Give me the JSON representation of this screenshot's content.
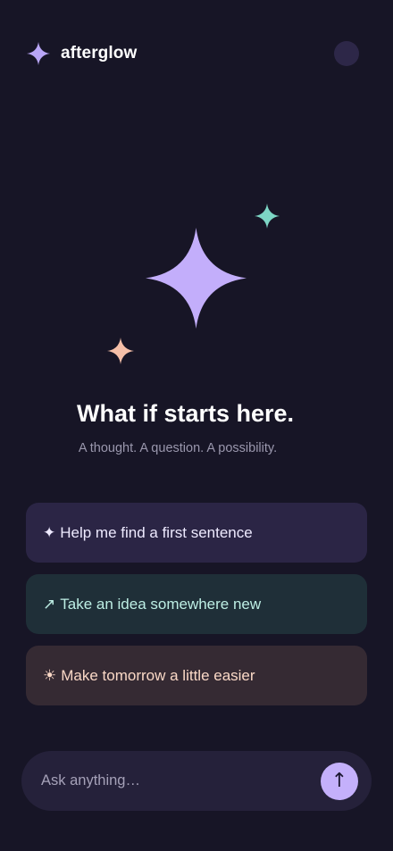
{
  "app": {
    "name": "afterglow",
    "logo_icon": "sparkle-icon",
    "avatar_icon": "avatar"
  },
  "hero": {
    "headline": "What if starts here.",
    "subline": "A thought. A question. A possibility.",
    "decor_icons": [
      "sparkle-large-icon",
      "sparkle-teal-icon",
      "sparkle-peach-icon"
    ]
  },
  "suggestions": [
    {
      "glyph": "✦",
      "icon": "sparkle-icon",
      "label": "Help me find a first sentence"
    },
    {
      "glyph": "↗",
      "icon": "arrow-up-right-icon",
      "label": "Take an idea somewhere new"
    },
    {
      "glyph": "☀",
      "icon": "sun-icon",
      "label": "Make tomorrow a little easier"
    }
  ],
  "composer": {
    "placeholder": "Ask anything…",
    "value": "",
    "send_glyph": "↑",
    "send_icon": "arrow-up-icon"
  },
  "colors": {
    "background": "#171526",
    "accent_purple": "#c4b0fb",
    "accent_teal": "#7dd6c5",
    "accent_peach": "#f5bfa8",
    "card_purple": "#2b2545",
    "card_teal": "#1f2f38",
    "card_peach": "#352a33"
  }
}
